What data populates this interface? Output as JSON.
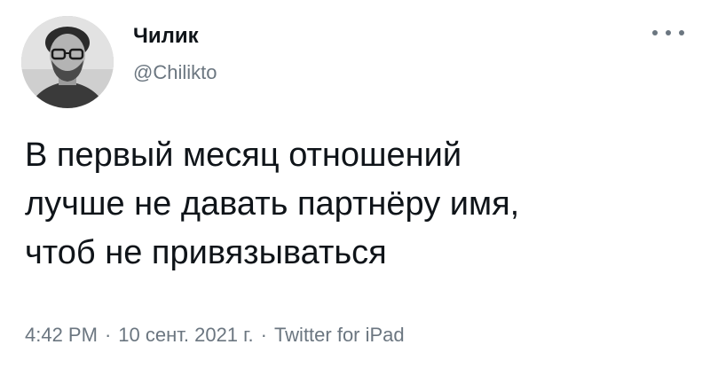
{
  "tweet": {
    "author_name": "Чилик",
    "author_handle": "@Chilikto",
    "text_lines": [
      "В первый месяц отношений",
      "лучше не давать партнёру имя,",
      "чтоб не привязываться"
    ],
    "time": "4:42 PM",
    "date": "10 сент. 2021 г.",
    "source": "Twitter for iPad",
    "separator": "·"
  },
  "icons": {
    "more": "more-options-icon",
    "avatar": "avatar"
  },
  "colors": {
    "text": "#0f1419",
    "secondary": "#6b7680",
    "background": "#ffffff"
  }
}
